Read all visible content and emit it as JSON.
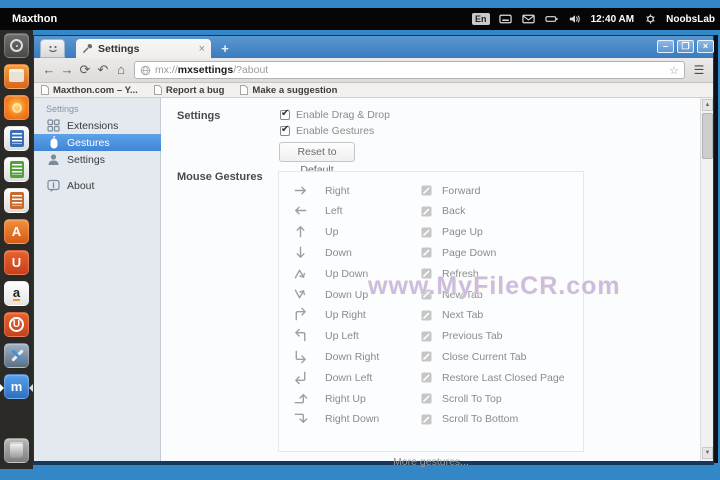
{
  "colors": {
    "wallpaper": "#3487c7",
    "titlebar": "#3a7cc0",
    "nav_selected": "#3f85d6",
    "panel": "#060606"
  },
  "top_panel": {
    "app_name": "Maxthon",
    "keyboard_layout": "En",
    "time": "12:40 AM",
    "user": "NoobsLab",
    "indicator_icons": [
      "keyboard-indicator-icon",
      "mail-icon",
      "battery-icon",
      "volume-icon",
      "session-gear-icon"
    ]
  },
  "launcher": {
    "items": [
      {
        "name": "dash-home"
      },
      {
        "name": "files"
      },
      {
        "name": "firefox"
      },
      {
        "name": "libreoffice-writer"
      },
      {
        "name": "libreoffice-calc"
      },
      {
        "name": "libreoffice-impress"
      },
      {
        "name": "software-center",
        "glyph": "A"
      },
      {
        "name": "ubuntu-one",
        "glyph": "U"
      },
      {
        "name": "amazon",
        "glyph": "a"
      },
      {
        "name": "ubuntu-one-music",
        "glyph": "U"
      },
      {
        "name": "system-settings"
      },
      {
        "name": "maxthon",
        "glyph": "m"
      },
      {
        "name": "trash"
      }
    ]
  },
  "browser": {
    "window_controls": {
      "minimize": "–",
      "maximize": "❐",
      "close": "×"
    },
    "tab": {
      "title": "Settings",
      "close": "×"
    },
    "new_tab_button": "+",
    "toolbar": {
      "back": "←",
      "forward": "→",
      "refresh": "⟳",
      "undo": "↶",
      "home": "⌂",
      "url": {
        "scheme": "mx://",
        "host": "mxsettings",
        "path": "/?about"
      },
      "star": "☆",
      "menu": "☰"
    },
    "bookmarks": [
      "Maxthon.com – Y...",
      "Report a bug",
      "Make a suggestion"
    ],
    "scrollbar": {
      "up": "▲",
      "down": "▼"
    }
  },
  "settings_page": {
    "nav": {
      "header": "Settings",
      "items": [
        {
          "label": "Extensions",
          "icon": "extensions-icon",
          "selected": false
        },
        {
          "label": "Gestures",
          "icon": "gestures-icon",
          "selected": true
        },
        {
          "label": "Settings",
          "icon": "user-icon",
          "selected": false
        },
        {
          "label": "About",
          "icon": "about-icon",
          "selected": false
        }
      ]
    },
    "settings_section": {
      "heading": "Settings",
      "checkboxes": [
        {
          "label": "Enable Drag & Drop",
          "checked": true
        },
        {
          "label": "Enable Gestures",
          "checked": true
        }
      ],
      "reset_button": "Reset to Default"
    },
    "gestures_section": {
      "heading": "Mouse Gestures",
      "rows": [
        {
          "gesture": "Right",
          "icon": "arrow-right",
          "action": "Forward"
        },
        {
          "gesture": "Left",
          "icon": "arrow-left",
          "action": "Back"
        },
        {
          "gesture": "Up",
          "icon": "arrow-up",
          "action": "Page Up"
        },
        {
          "gesture": "Down",
          "icon": "arrow-down",
          "action": "Page Down"
        },
        {
          "gesture": "Up Down",
          "icon": "arrow-up-down",
          "action": "Refresh"
        },
        {
          "gesture": "Down Up",
          "icon": "arrow-down-up",
          "action": "New Tab"
        },
        {
          "gesture": "Up Right",
          "icon": "arrow-up-right",
          "action": "Next Tab"
        },
        {
          "gesture": "Up Left",
          "icon": "arrow-up-left",
          "action": "Previous Tab"
        },
        {
          "gesture": "Down Right",
          "icon": "arrow-down-right",
          "action": "Close Current Tab"
        },
        {
          "gesture": "Down Left",
          "icon": "arrow-down-left",
          "action": "Restore Last Closed Page"
        },
        {
          "gesture": "Right Up",
          "icon": "arrow-right-up",
          "action": "Scroll To Top"
        },
        {
          "gesture": "Right Down",
          "icon": "arrow-right-down",
          "action": "Scroll To Bottom"
        }
      ],
      "more_link": "More gestures..."
    }
  },
  "watermark": "www.MyFileCR.com"
}
